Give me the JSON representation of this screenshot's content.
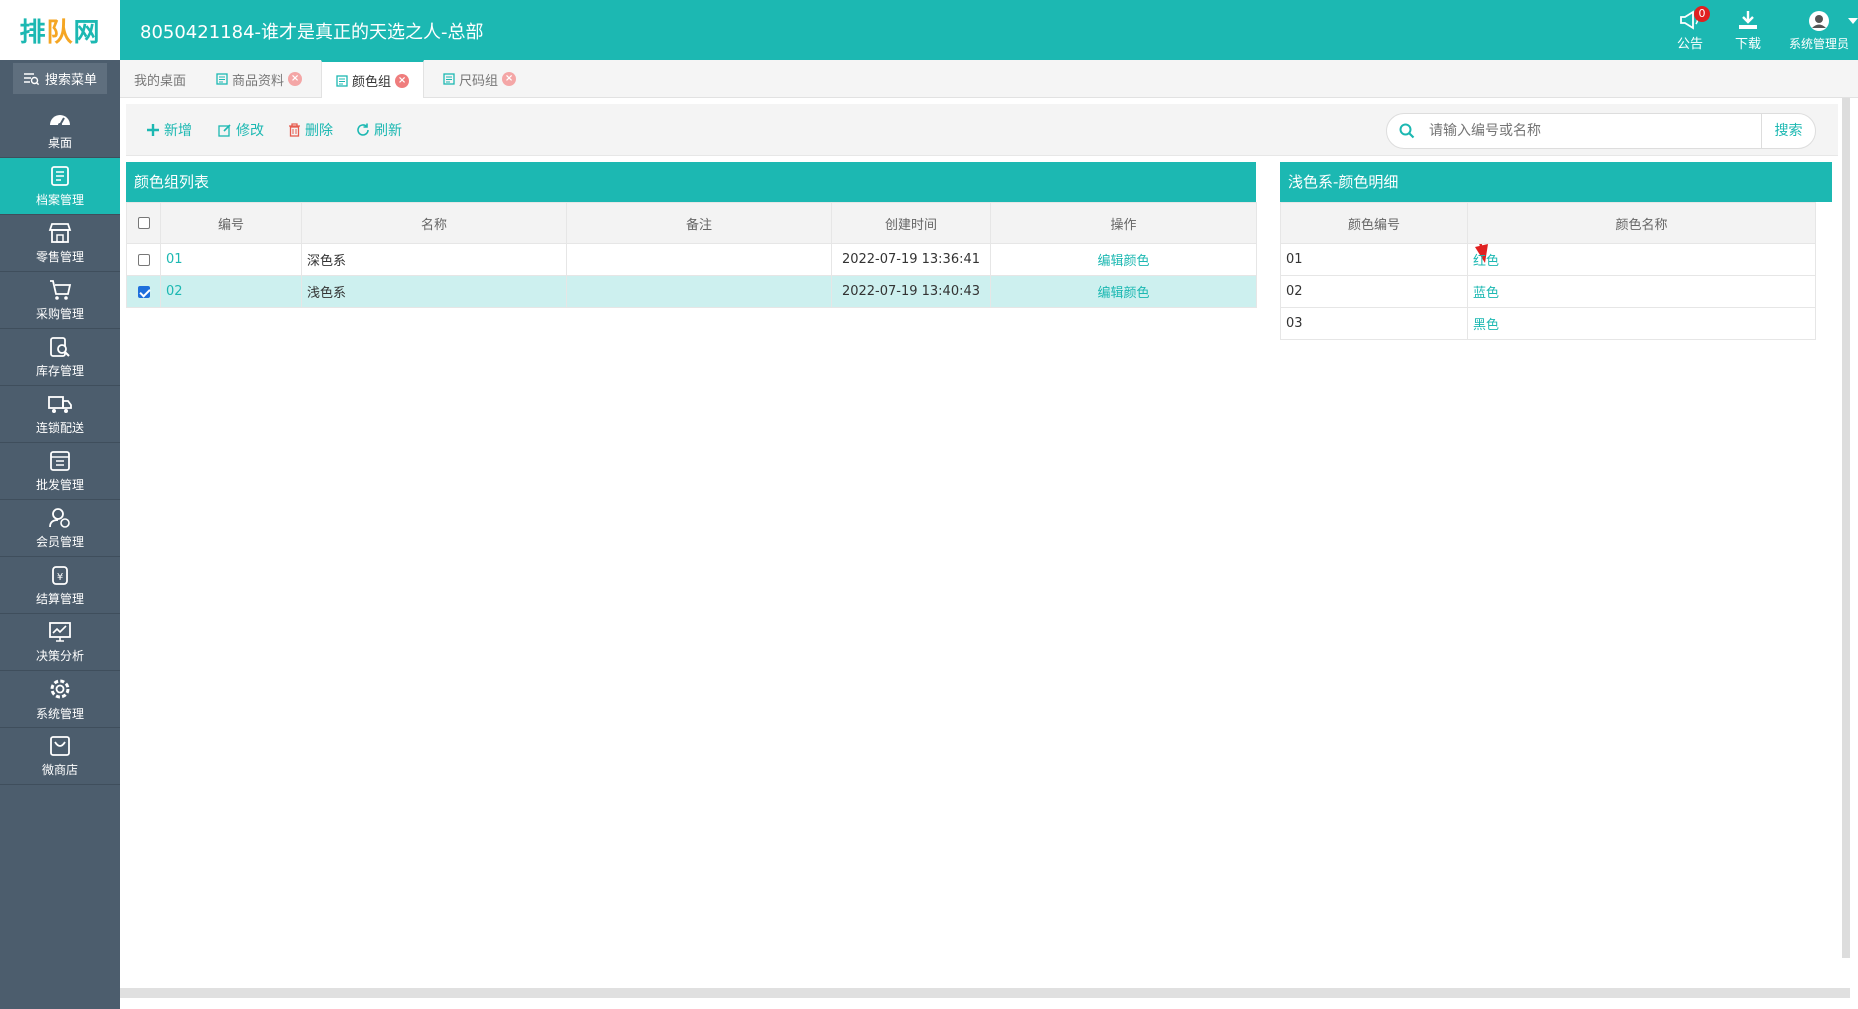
{
  "header": {
    "logo_text": [
      "排",
      "队",
      "网"
    ],
    "title": "8050421184-谁才是真正的天选之人-总部",
    "notice_label": "公告",
    "notice_count": "0",
    "download_label": "下载",
    "user_label": "系统管理员"
  },
  "sidebar": {
    "search_label": "搜索菜单",
    "items": [
      {
        "label": "桌面",
        "icon": "dashboard-icon"
      },
      {
        "label": "档案管理",
        "icon": "archive-icon"
      },
      {
        "label": "零售管理",
        "icon": "store-icon"
      },
      {
        "label": "采购管理",
        "icon": "cart-icon"
      },
      {
        "label": "库存管理",
        "icon": "inventory-icon"
      },
      {
        "label": "连锁配送",
        "icon": "truck-icon"
      },
      {
        "label": "批发管理",
        "icon": "wholesale-icon"
      },
      {
        "label": "会员管理",
        "icon": "member-icon"
      },
      {
        "label": "结算管理",
        "icon": "settlement-icon"
      },
      {
        "label": "决策分析",
        "icon": "analysis-icon"
      },
      {
        "label": "系统管理",
        "icon": "gear-icon"
      },
      {
        "label": "微商店",
        "icon": "shop-bag-icon"
      }
    ],
    "active_index": 1
  },
  "tabs": [
    {
      "label": "我的桌面"
    },
    {
      "label": "商品资料"
    },
    {
      "label": "颜色组"
    },
    {
      "label": "尺码组"
    }
  ],
  "toolbar": {
    "add_label": "新增",
    "edit_label": "修改",
    "delete_label": "删除",
    "refresh_label": "刷新",
    "search_placeholder": "请输入编号或名称",
    "search_button": "搜索"
  },
  "left_panel": {
    "title": "颜色组列表",
    "columns": [
      "编号",
      "名称",
      "备注",
      "创建时间",
      "操作"
    ],
    "rows": [
      {
        "code": "01",
        "name": "深色系",
        "remark": "",
        "created": "2022-07-19 13:36:41",
        "action": "编辑颜色",
        "checked": false
      },
      {
        "code": "02",
        "name": "浅色系",
        "remark": "",
        "created": "2022-07-19 13:40:43",
        "action": "编辑颜色",
        "checked": true
      }
    ]
  },
  "right_panel": {
    "title": "浅色系-颜色明细",
    "columns": [
      "颜色编号",
      "颜色名称"
    ],
    "rows": [
      {
        "code": "01",
        "name": "红色"
      },
      {
        "code": "02",
        "name": "蓝色"
      },
      {
        "code": "03",
        "name": "黑色"
      }
    ]
  },
  "colors": {
    "accent": "#1cb8b2",
    "sidebar": "#4c5d6d",
    "selected_row": "#cdf0ef",
    "annotation_arrow": "#e02020"
  }
}
